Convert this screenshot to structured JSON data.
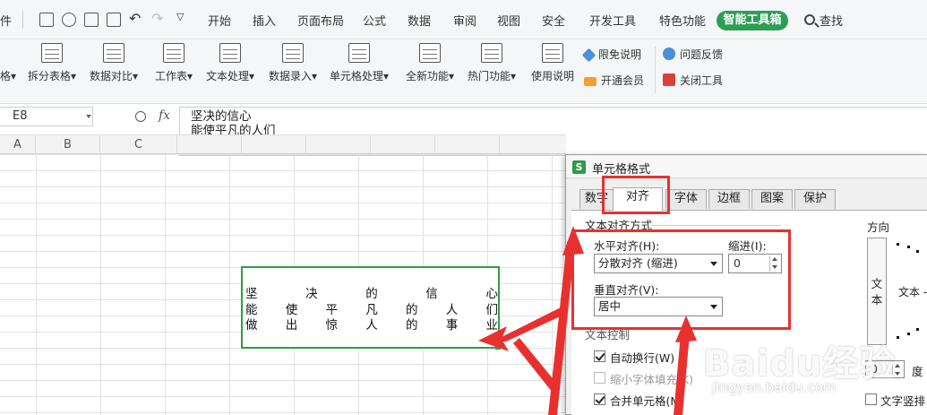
{
  "menubar": {
    "file_fragment": "件",
    "tabs": [
      "开始",
      "插入",
      "页面布局",
      "公式",
      "数据",
      "审阅",
      "视图",
      "安全",
      "开发工具",
      "特色功能",
      "智能工具箱"
    ],
    "search": "查找"
  },
  "ribbon": {
    "left_fragment": "格",
    "buttons": [
      "拆分表格",
      "数据对比",
      "工作表",
      "文本处理",
      "数据录入",
      "单元格处理",
      "全新功能",
      "热门功能",
      "使用说明"
    ],
    "small": {
      "disclaimer": "限免说明",
      "vip": "开通会员",
      "feedback": "问题反馈",
      "close_tool": "关闭工具"
    }
  },
  "formula_bar": {
    "cell_ref": "E8",
    "fx": "fx",
    "lines": [
      "坚决的信心",
      "能使平凡的人们",
      "做出惊人的事业"
    ]
  },
  "columns": [
    "A",
    "B",
    "C"
  ],
  "merged_cell": {
    "rows": [
      [
        "坚",
        "决",
        "的",
        "信",
        "心"
      ],
      [
        "能",
        "使",
        "平",
        "凡",
        "的",
        "人",
        "们"
      ],
      [
        "做",
        "出",
        "惊",
        "人",
        "的",
        "事",
        "业"
      ]
    ]
  },
  "dialog": {
    "title": "单元格格式",
    "logo": "S",
    "tabs": [
      "数字",
      "对齐",
      "字体",
      "边框",
      "图案",
      "保护"
    ],
    "active_tab": "对齐",
    "text_alignment_group": "文本对齐方式",
    "horizontal_label": "水平对齐(H):",
    "horizontal_value": "分散对齐 (缩进)",
    "indent_label": "缩进(I):",
    "indent_value": "0",
    "vertical_label": "垂直对齐(V):",
    "vertical_value": "居中",
    "text_control_group": "文本控制",
    "wrap_text": "自动换行(W)",
    "shrink_to_fit": "缩小字体填充(K)",
    "merge_cells": "合并单元格(M)",
    "orientation_group": "方向",
    "orientation_vertical": "文本",
    "orientation_dial": "文本 -",
    "degrees_value": "0",
    "degrees_label": "度",
    "vertical_text": "文字竖排"
  },
  "watermark": {
    "brand": "Baidu经验",
    "url": "jingyan.baidu.com"
  },
  "colors": {
    "accent_green": "#2e9e55",
    "annotation_red": "#e8312f",
    "selection_green": "#2e9e45"
  }
}
